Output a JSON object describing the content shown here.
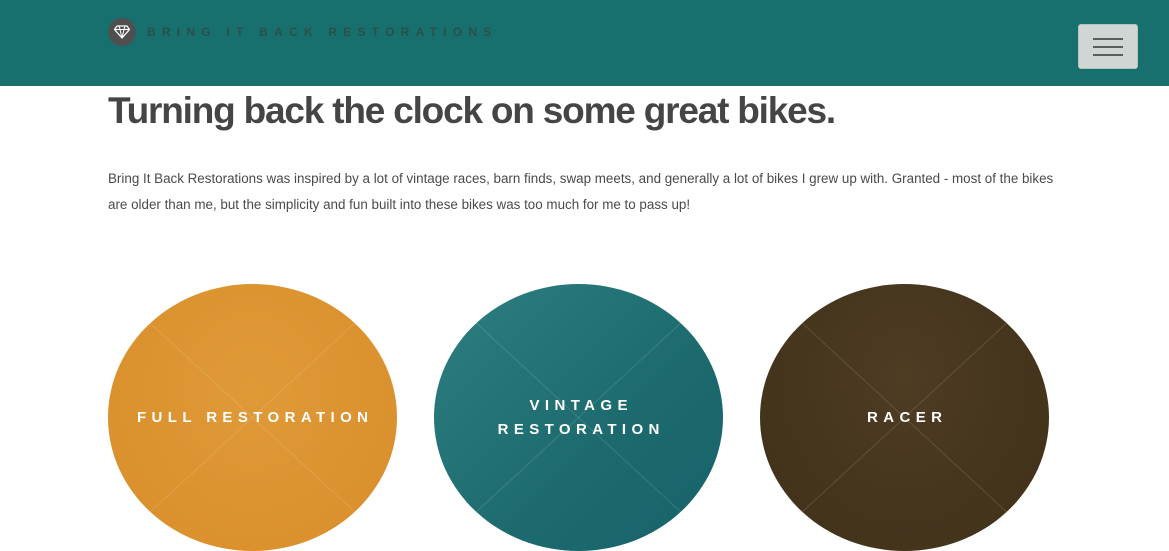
{
  "header": {
    "logo_text": "Bring It Back Restorations",
    "logo_icon": "diamond-icon",
    "menu_icon": "hamburger-icon"
  },
  "main": {
    "headline": "Turning back the clock on some great bikes.",
    "intro": "Bring It Back Restorations was inspired by a lot of vintage races, barn finds, swap meets, and generally a lot of bikes I grew up with. Granted - most of the bikes are older than me, but the simplicity and fun built into these bikes was too much for me to pass up!"
  },
  "tiles": [
    {
      "label": "Full Restoration",
      "color": "#d88d2a"
    },
    {
      "label": "Vintage Restoration",
      "color": "#1c6a6d"
    },
    {
      "label": "Racer",
      "color": "#453520"
    }
  ],
  "colors": {
    "header_bg": "#17706d",
    "heading_text": "#454545",
    "body_text": "#4a4a4a"
  }
}
